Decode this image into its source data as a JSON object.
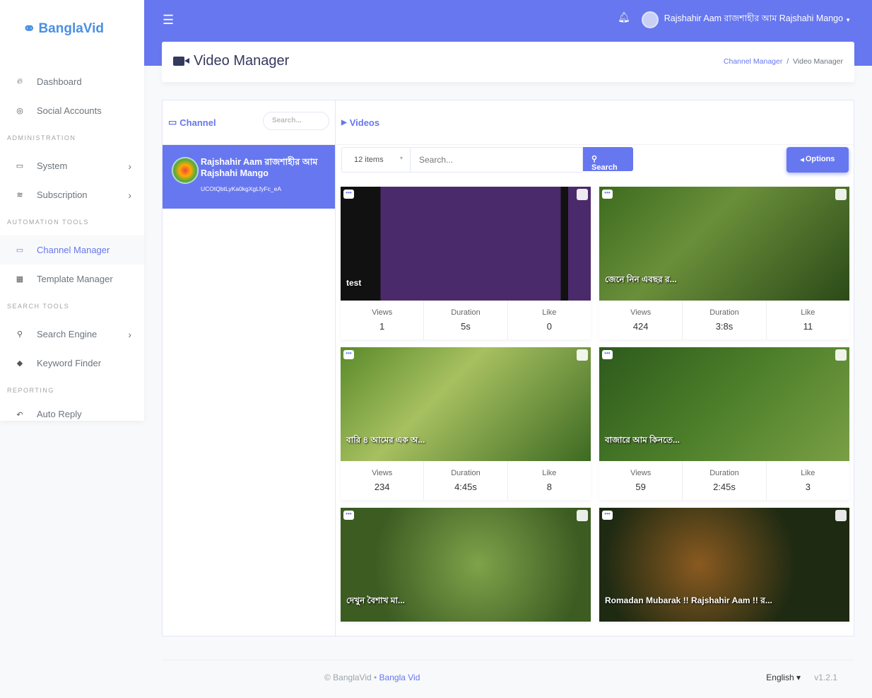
{
  "brand": "BanglaVid",
  "topbar": {
    "user_name": "Rajshahir Aam রাজশাহীর আম Rajshahi Mango"
  },
  "sidebar": {
    "dashboard": "Dashboard",
    "social_accounts": "Social Accounts",
    "h_admin": "ADMINISTRATION",
    "system": "System",
    "subscription": "Subscription",
    "h_automation": "AUTOMATION TOOLS",
    "channel_manager": "Channel Manager",
    "template_manager": "Template Manager",
    "h_search": "SEARCH TOOLS",
    "search_engine": "Search Engine",
    "keyword_finder": "Keyword Finder",
    "h_reporting": "REPORTING",
    "auto_reply": "Auto Reply"
  },
  "header": {
    "title": "Video Manager",
    "breadcrumb": [
      "Channel Manager",
      "Video Manager"
    ]
  },
  "channel_panel": {
    "title": "Channel",
    "search_placeholder": "Search...",
    "channel": {
      "name": "Rajshahir Aam রাজশাহীর আম Rajshahi Mango",
      "id": "UCOtQbtLyKa0kgXgLfyFc_eA"
    }
  },
  "videos_panel": {
    "title": "Videos",
    "items_select": "12 items",
    "search_placeholder": "Search...",
    "search_button": "Search",
    "options_button": "Options"
  },
  "stat_labels": {
    "views": "Views",
    "duration": "Duration",
    "like": "Like"
  },
  "videos": [
    {
      "title": "test",
      "views": "1",
      "duration": "5s",
      "like": "0"
    },
    {
      "title": "জেনে নিন এবছর র...",
      "views": "424",
      "duration": "3:8s",
      "like": "11"
    },
    {
      "title": "বারি ৪ আমের এক অ...",
      "views": "234",
      "duration": "4:45s",
      "like": "8"
    },
    {
      "title": "বাজারে আম কিনতে...",
      "views": "59",
      "duration": "2:45s",
      "like": "3"
    },
    {
      "title": "দেখুন বৈশাখ মা...",
      "views": "",
      "duration": "",
      "like": ""
    },
    {
      "title": "Romadan Mubarak !! Rajshahir Aam !! র...",
      "views": "",
      "duration": "",
      "like": ""
    }
  ],
  "footer": {
    "copyright": "© BanglaVid",
    "link": "Bangla Vid",
    "language": "English",
    "version": "v1.2.1"
  }
}
